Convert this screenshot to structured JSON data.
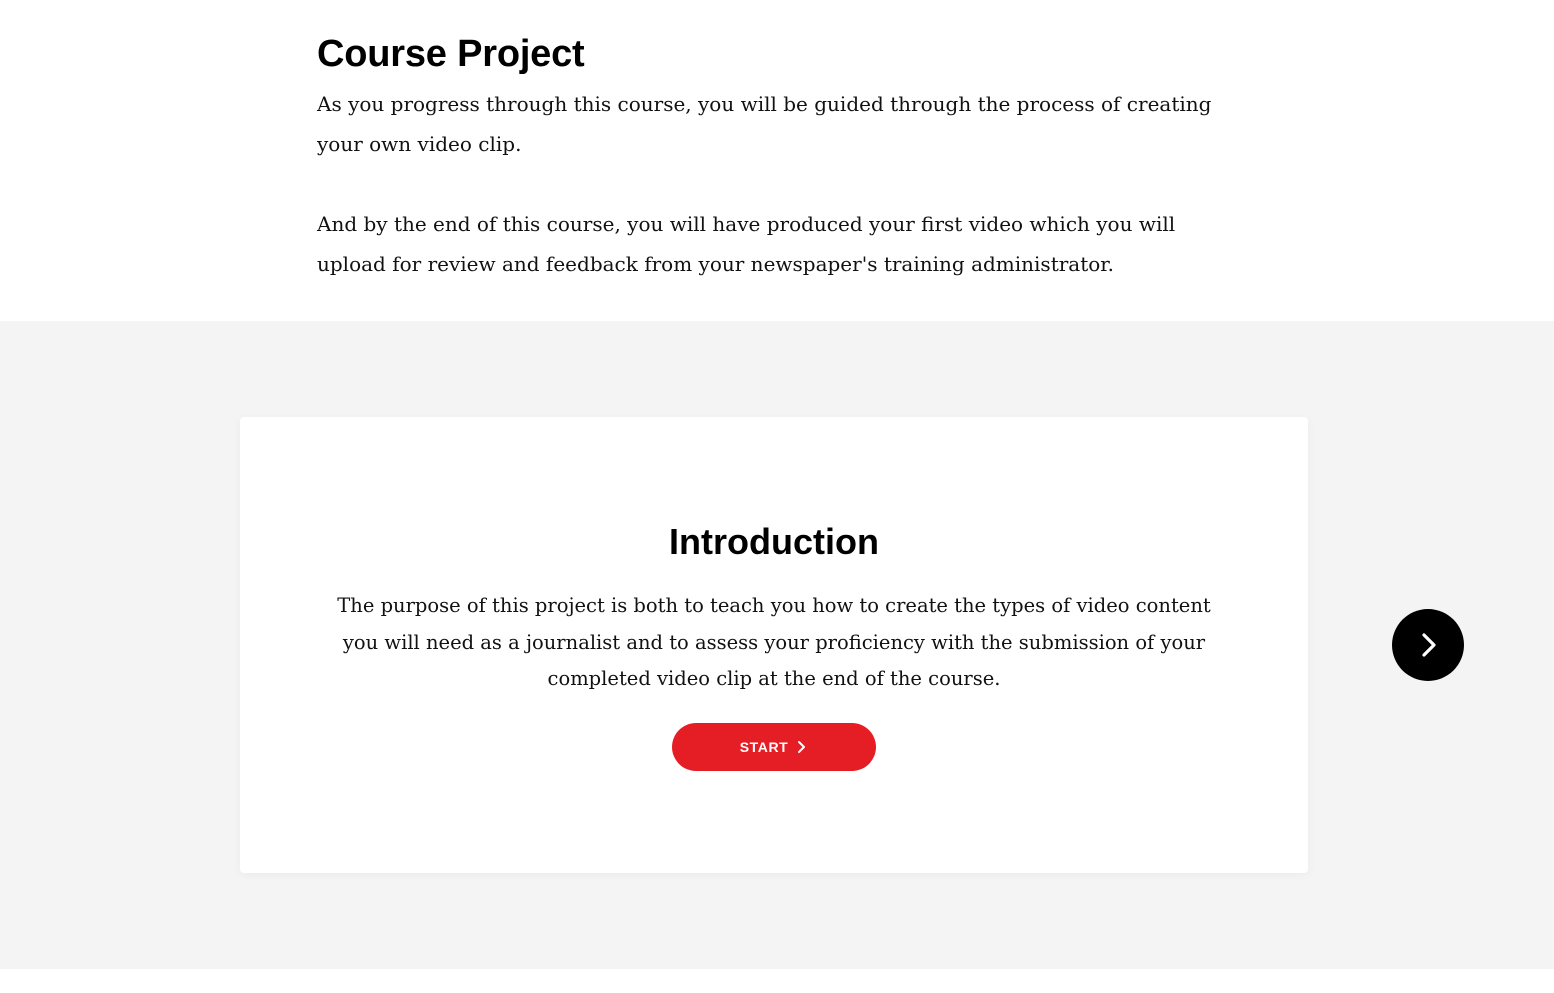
{
  "course_project": {
    "title": "Course Project",
    "paragraphs": [
      "As you progress through this course, you will be guided through the process of creating your own video clip.",
      "And by the end of this course, you will have produced your first video which you will upload for review and feedback from your newspaper's training administrator."
    ]
  },
  "intro_card": {
    "title": "Introduction",
    "text": "The purpose of this project is both to teach you how to create the types of video content you will need as a journalist and to assess your proficiency with the submission of your completed video clip at the end of the course.",
    "start_label": "START",
    "start_icon": "chevron-right-icon"
  },
  "navigation": {
    "next_icon": "chevron-right-icon"
  },
  "colors": {
    "accent": "#e51e25",
    "section_background": "#f4f4f4",
    "nav_button": "#000000"
  }
}
